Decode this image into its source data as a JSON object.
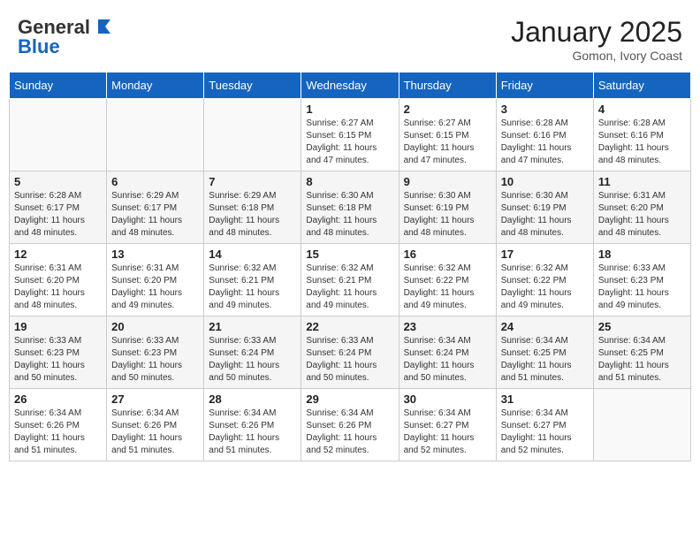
{
  "header": {
    "logo_general": "General",
    "logo_blue": "Blue",
    "month_title": "January 2025",
    "subtitle": "Gomon, Ivory Coast"
  },
  "days_of_week": [
    "Sunday",
    "Monday",
    "Tuesday",
    "Wednesday",
    "Thursday",
    "Friday",
    "Saturday"
  ],
  "weeks": [
    [
      {
        "day": "",
        "info": ""
      },
      {
        "day": "",
        "info": ""
      },
      {
        "day": "",
        "info": ""
      },
      {
        "day": "1",
        "info": "Sunrise: 6:27 AM\nSunset: 6:15 PM\nDaylight: 11 hours and 47 minutes."
      },
      {
        "day": "2",
        "info": "Sunrise: 6:27 AM\nSunset: 6:15 PM\nDaylight: 11 hours and 47 minutes."
      },
      {
        "day": "3",
        "info": "Sunrise: 6:28 AM\nSunset: 6:16 PM\nDaylight: 11 hours and 47 minutes."
      },
      {
        "day": "4",
        "info": "Sunrise: 6:28 AM\nSunset: 6:16 PM\nDaylight: 11 hours and 48 minutes."
      }
    ],
    [
      {
        "day": "5",
        "info": "Sunrise: 6:28 AM\nSunset: 6:17 PM\nDaylight: 11 hours and 48 minutes."
      },
      {
        "day": "6",
        "info": "Sunrise: 6:29 AM\nSunset: 6:17 PM\nDaylight: 11 hours and 48 minutes."
      },
      {
        "day": "7",
        "info": "Sunrise: 6:29 AM\nSunset: 6:18 PM\nDaylight: 11 hours and 48 minutes."
      },
      {
        "day": "8",
        "info": "Sunrise: 6:30 AM\nSunset: 6:18 PM\nDaylight: 11 hours and 48 minutes."
      },
      {
        "day": "9",
        "info": "Sunrise: 6:30 AM\nSunset: 6:19 PM\nDaylight: 11 hours and 48 minutes."
      },
      {
        "day": "10",
        "info": "Sunrise: 6:30 AM\nSunset: 6:19 PM\nDaylight: 11 hours and 48 minutes."
      },
      {
        "day": "11",
        "info": "Sunrise: 6:31 AM\nSunset: 6:20 PM\nDaylight: 11 hours and 48 minutes."
      }
    ],
    [
      {
        "day": "12",
        "info": "Sunrise: 6:31 AM\nSunset: 6:20 PM\nDaylight: 11 hours and 48 minutes."
      },
      {
        "day": "13",
        "info": "Sunrise: 6:31 AM\nSunset: 6:20 PM\nDaylight: 11 hours and 49 minutes."
      },
      {
        "day": "14",
        "info": "Sunrise: 6:32 AM\nSunset: 6:21 PM\nDaylight: 11 hours and 49 minutes."
      },
      {
        "day": "15",
        "info": "Sunrise: 6:32 AM\nSunset: 6:21 PM\nDaylight: 11 hours and 49 minutes."
      },
      {
        "day": "16",
        "info": "Sunrise: 6:32 AM\nSunset: 6:22 PM\nDaylight: 11 hours and 49 minutes."
      },
      {
        "day": "17",
        "info": "Sunrise: 6:32 AM\nSunset: 6:22 PM\nDaylight: 11 hours and 49 minutes."
      },
      {
        "day": "18",
        "info": "Sunrise: 6:33 AM\nSunset: 6:23 PM\nDaylight: 11 hours and 49 minutes."
      }
    ],
    [
      {
        "day": "19",
        "info": "Sunrise: 6:33 AM\nSunset: 6:23 PM\nDaylight: 11 hours and 50 minutes."
      },
      {
        "day": "20",
        "info": "Sunrise: 6:33 AM\nSunset: 6:23 PM\nDaylight: 11 hours and 50 minutes."
      },
      {
        "day": "21",
        "info": "Sunrise: 6:33 AM\nSunset: 6:24 PM\nDaylight: 11 hours and 50 minutes."
      },
      {
        "day": "22",
        "info": "Sunrise: 6:33 AM\nSunset: 6:24 PM\nDaylight: 11 hours and 50 minutes."
      },
      {
        "day": "23",
        "info": "Sunrise: 6:34 AM\nSunset: 6:24 PM\nDaylight: 11 hours and 50 minutes."
      },
      {
        "day": "24",
        "info": "Sunrise: 6:34 AM\nSunset: 6:25 PM\nDaylight: 11 hours and 51 minutes."
      },
      {
        "day": "25",
        "info": "Sunrise: 6:34 AM\nSunset: 6:25 PM\nDaylight: 11 hours and 51 minutes."
      }
    ],
    [
      {
        "day": "26",
        "info": "Sunrise: 6:34 AM\nSunset: 6:26 PM\nDaylight: 11 hours and 51 minutes."
      },
      {
        "day": "27",
        "info": "Sunrise: 6:34 AM\nSunset: 6:26 PM\nDaylight: 11 hours and 51 minutes."
      },
      {
        "day": "28",
        "info": "Sunrise: 6:34 AM\nSunset: 6:26 PM\nDaylight: 11 hours and 51 minutes."
      },
      {
        "day": "29",
        "info": "Sunrise: 6:34 AM\nSunset: 6:26 PM\nDaylight: 11 hours and 52 minutes."
      },
      {
        "day": "30",
        "info": "Sunrise: 6:34 AM\nSunset: 6:27 PM\nDaylight: 11 hours and 52 minutes."
      },
      {
        "day": "31",
        "info": "Sunrise: 6:34 AM\nSunset: 6:27 PM\nDaylight: 11 hours and 52 minutes."
      },
      {
        "day": "",
        "info": ""
      }
    ]
  ]
}
